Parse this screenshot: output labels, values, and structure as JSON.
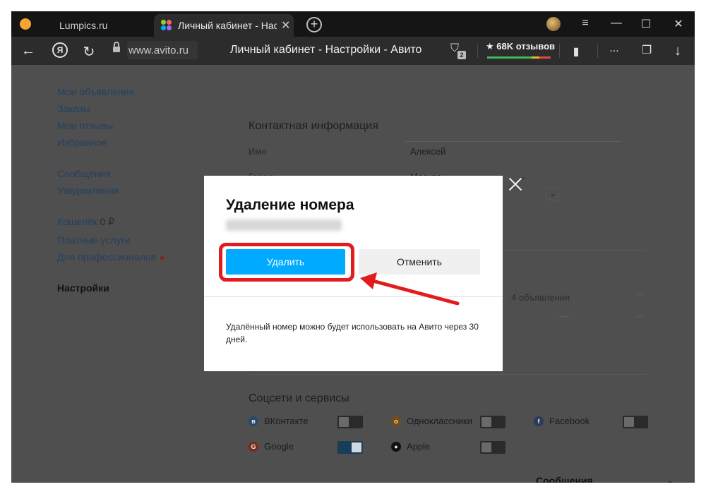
{
  "browser": {
    "tabs": [
      {
        "label": "Lumpics.ru"
      },
      {
        "label": "Личный кабинет - Настройки - Авито"
      }
    ],
    "new_tab_icon": "plus-icon",
    "window_controls": [
      "≡",
      "—",
      "☐",
      "✕"
    ],
    "address": {
      "url": "www.avito.ru",
      "page_title": "Личный кабинет - Настройки - Авито",
      "protect_badge": "2",
      "reviews": "★ 68K отзывов",
      "more": "...",
      "nav_icons": {
        "back": "←",
        "refresh": "↻",
        "yandex": "Я",
        "download": "↓"
      }
    }
  },
  "sidebar": {
    "group1": [
      {
        "label": "Мои объявления"
      },
      {
        "label": "Заказы"
      },
      {
        "label": "Мои отзывы"
      },
      {
        "label": "Избранное"
      }
    ],
    "group2": [
      {
        "label": "Сообщения"
      },
      {
        "label": "Уведомления"
      }
    ],
    "group3": [
      {
        "label": "Кошелёк",
        "value": "0 ₽"
      },
      {
        "label": "Платные услуги"
      },
      {
        "label": "Для профессионалов"
      }
    ],
    "active": "Настройки"
  },
  "content": {
    "contact_title": "Контактная информация",
    "name_label": "Имя",
    "name_value": "Алексей",
    "city_label": "Город",
    "city_value": "Москва",
    "ads_count": "4 объявления",
    "social_title": "Соцсети и сервисы",
    "socials": [
      {
        "label": "ВКонтакте",
        "icon": "vk-icon",
        "color": "#2a4a6a",
        "enabled": false
      },
      {
        "label": "Одноклассники",
        "icon": "ok-icon",
        "color": "#7a4a10",
        "enabled": false
      },
      {
        "label": "Facebook",
        "icon": "facebook-icon",
        "color": "#2a3a5a",
        "enabled": false
      },
      {
        "label": "Google",
        "icon": "google-icon",
        "color": "#7a2a1a",
        "enabled": true
      },
      {
        "label": "Apple",
        "icon": "apple-icon",
        "color": "#111111",
        "enabled": false
      }
    ],
    "messages_bar": "Сообщения"
  },
  "modal": {
    "title": "Удаление номера",
    "delete_label": "Удалить",
    "cancel_label": "Отменить",
    "note": "Удалённый номер можно будет использовать на Авито через 30 дней."
  },
  "colors": {
    "primary_button": "#00aaff",
    "annotation": "#e21c1c"
  }
}
